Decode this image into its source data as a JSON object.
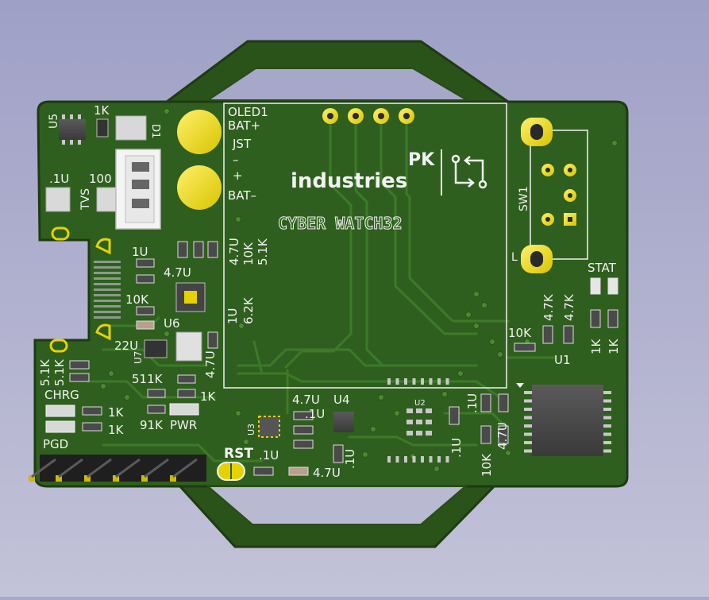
{
  "board": {
    "logo_line1": "PK",
    "logo_line2": "industries",
    "product_name": "CYBER WATCH32",
    "colors": {
      "background": "#a4a5c8",
      "soldermask": "#2f5f1e",
      "trace": "#3d7a28",
      "silkscreen": "#f2f2f2",
      "copper_pad": "#e6d200"
    }
  },
  "labels": {
    "u5": "U5",
    "r_1k_top": "1K",
    "d1": "D1",
    "c_01u": ".1U",
    "r_100": "100",
    "tvs": "TVS",
    "c_1u": "1U",
    "c_47u": "4.7U",
    "r_10k": "10K",
    "u6": "U6",
    "c_22u": "22U",
    "u7": "U7",
    "r_511k": "511K",
    "r_91k": "91K",
    "pwr": "PWR",
    "c_47u_b": "4.7U",
    "r_1k_b": "1K",
    "r_51k_a": "5.1K",
    "r_51k_b": "5.1K",
    "chrg": "CHRG",
    "r_1k_c": "1K",
    "r_1k_d": "1K",
    "pgd": "PGD",
    "rst": "RST",
    "oled1": "OLED1",
    "bat_plus": "BAT+",
    "jst": "JST",
    "minus": "–",
    "plus": "+",
    "bat_minus": "BAT–",
    "vert_47u": "4.7U",
    "vert_10k": "10K",
    "vert_51k": "5.1K",
    "vert_1u": "1U",
    "vert_62k": "6.2K",
    "sw1": "SW1",
    "stat": "STAT",
    "r_47k_a": "4.7K",
    "r_47k_b": "4.7K",
    "r_10k_b": "10K",
    "r_1k_e": "1K",
    "r_1k_f": "1K",
    "u1": "U1",
    "c_47u_c": "4.7U",
    "u4": "U4",
    "c_01u_b": ".1U",
    "c_1u_b": ".1U",
    "u2": "U2",
    "c_1u_c": ".1U",
    "c_1u_d": ".1U",
    "r_10k_c": "10K",
    "c_47u_d": "4.7U",
    "u3": "U3",
    "c_01u_c": ".1U",
    "c_47u_e": "4.7U",
    "c_1u_e": "1U"
  }
}
